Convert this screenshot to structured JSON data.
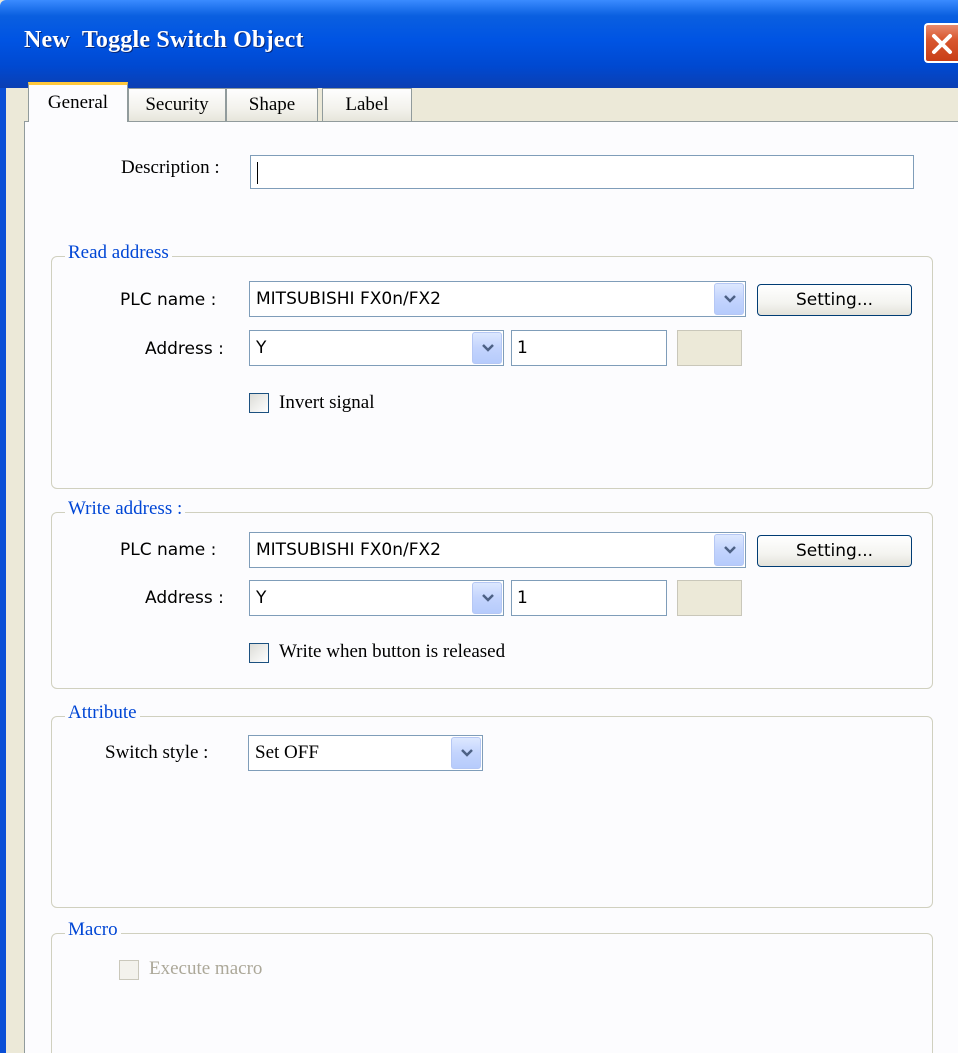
{
  "window": {
    "title": "New  Toggle Switch Object"
  },
  "tabs": [
    {
      "label": "General",
      "active": true
    },
    {
      "label": "Security",
      "active": false
    },
    {
      "label": "Shape",
      "active": false
    },
    {
      "label": "Label",
      "active": false
    }
  ],
  "general": {
    "description_label": "Description :",
    "description_value": ""
  },
  "read_address": {
    "title": "Read address",
    "plc_label": "PLC name :",
    "plc_value": "MITSUBISHI FX0n/FX2",
    "setting_label": "Setting...",
    "address_label": "Address :",
    "device_value": "Y",
    "address_value": "1",
    "invert_label": "Invert signal",
    "invert_checked": false
  },
  "write_address": {
    "title": "Write address :",
    "plc_label": "PLC name :",
    "plc_value": "MITSUBISHI FX0n/FX2",
    "setting_label": "Setting...",
    "address_label": "Address :",
    "device_value": "Y",
    "address_value": "1",
    "release_label": "Write when button is released",
    "release_checked": false
  },
  "attribute": {
    "title": "Attribute",
    "switch_style_label": "Switch style :",
    "switch_style_value": "Set OFF"
  },
  "macro": {
    "title": "Macro",
    "execute_label": "Execute macro",
    "execute_checked": false,
    "enabled": false
  },
  "colors": {
    "title_bar": "#0054e3",
    "group_title": "#0046d5",
    "tab_highlight": "#ffc83c",
    "close_button": "#d9572f"
  }
}
